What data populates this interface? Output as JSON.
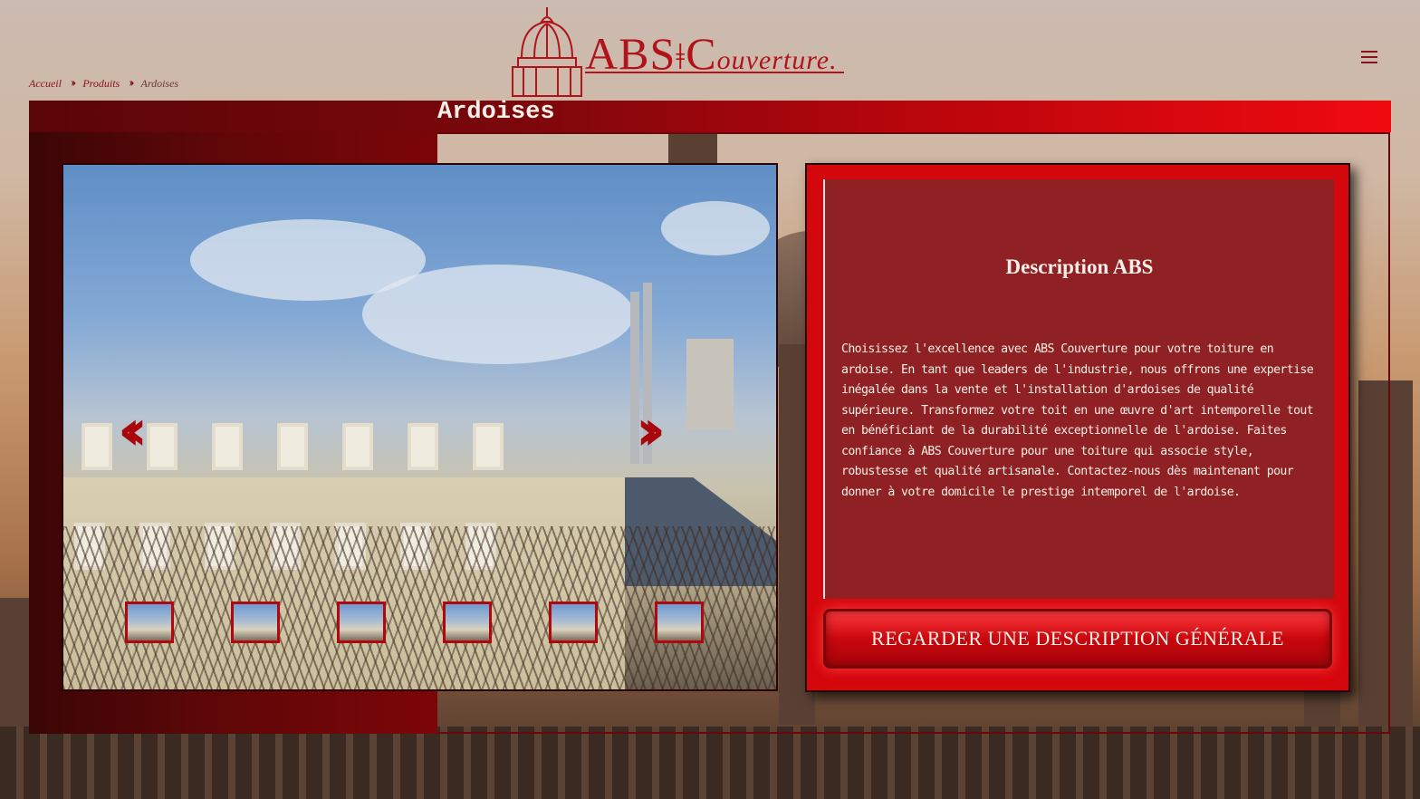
{
  "brand": {
    "logo_main": "ABS",
    "logo_initial": "C",
    "logo_rest": "ouverture.",
    "accent_color": "#b0141a"
  },
  "header": {
    "menu_icon": "hamburger-menu-icon"
  },
  "breadcrumb": {
    "items": [
      "Accueil",
      "Produits",
      "Ardoises"
    ],
    "separator_icon": "double-chevron-right-icon"
  },
  "page": {
    "title": "Ardoises"
  },
  "carousel": {
    "prev_icon": "double-chevron-left-icon",
    "next_icon": "double-chevron-right-icon",
    "thumbnail_count": 6
  },
  "description": {
    "title": "Description ABS",
    "body": "Choisissez l'excellence avec ABS Couverture pour votre toiture en ardoise. En tant que leaders de l'industrie, nous offrons une expertise inégalée dans la vente et l'installation d'ardoises de qualité supérieure. Transformez votre toit en une œuvre d'art intemporelle tout en bénéficiant de la durabilité exceptionnelle de l'ardoise. Faites confiance à ABS Couverture pour une toiture qui associe style, robustesse et qualité artisanale. Contactez-nous dès maintenant pour donner à votre domicile le prestige intemporel de l'ardoise.",
    "button_label": "REGARDER UNE DESCRIPTION GÉNÉRALE"
  }
}
